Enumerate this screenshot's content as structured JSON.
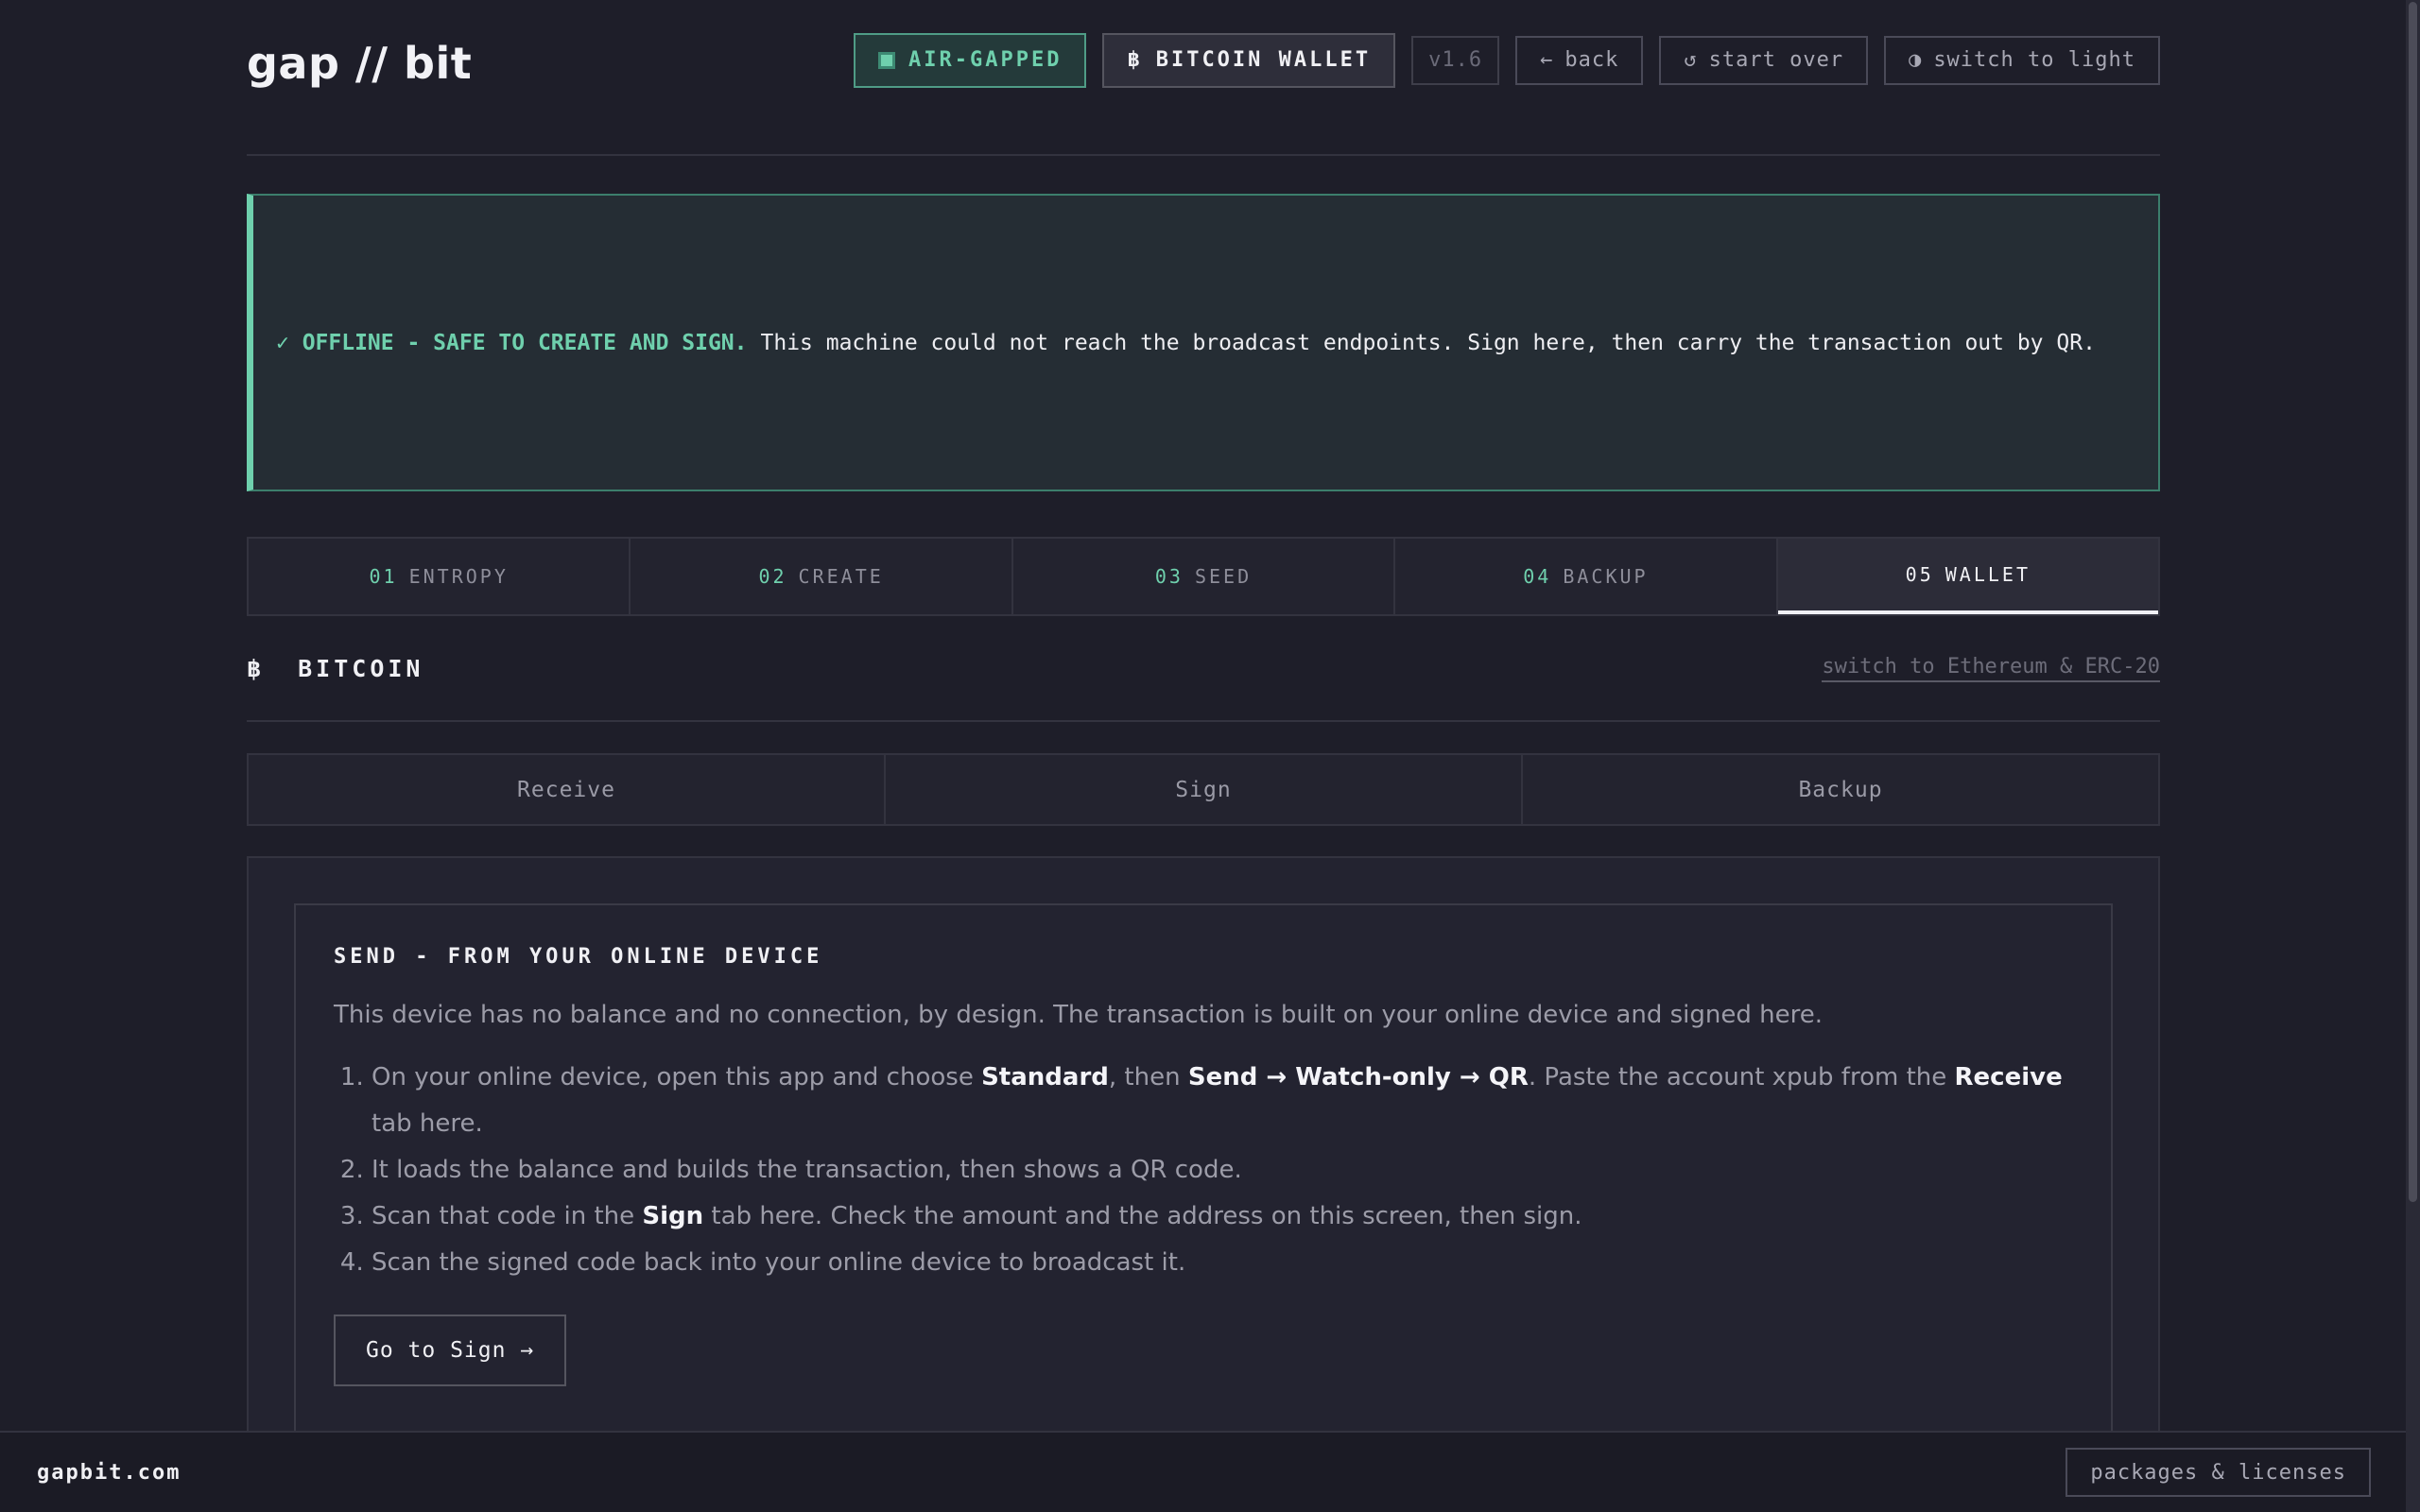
{
  "header": {
    "logo": "gap // bit",
    "air_gapped": "AIR-GAPPED",
    "wallet_symbol": "฿",
    "wallet_label": "BITCOIN WALLET",
    "version": "v1.6",
    "back_glyph": "←",
    "back": "back",
    "start_over_glyph": "↺",
    "start_over": "start over",
    "theme_glyph": "◑",
    "theme": "switch to light"
  },
  "banner": {
    "status": "✓ OFFLINE - SAFE TO CREATE AND SIGN.",
    "message": "This machine could not reach the broadcast endpoints. Sign here, then carry the transaction out by QR."
  },
  "steps": [
    {
      "num": "01",
      "label": "ENTROPY"
    },
    {
      "num": "02",
      "label": "CREATE"
    },
    {
      "num": "03",
      "label": "SEED"
    },
    {
      "num": "04",
      "label": "BACKUP"
    },
    {
      "num": "05",
      "label": "WALLET"
    }
  ],
  "section": {
    "symbol": "฿",
    "title": "BITCOIN",
    "switch_link": "switch to Ethereum & ERC-20"
  },
  "subtabs": [
    "Receive",
    "Sign",
    "Backup"
  ],
  "card": {
    "title": "SEND - FROM YOUR ONLINE DEVICE",
    "description": "This device has no balance and no connection, by design. The transaction is built on your online device and signed here.",
    "step1": {
      "a": "On your online device, open this app and choose ",
      "b": "Standard",
      "c": ", then ",
      "d": "Send → Watch-only → QR",
      "e": ". Paste the account xpub from the ",
      "f": "Receive",
      "g": " tab here."
    },
    "step2": "It loads the balance and builds the transaction, then shows a QR code.",
    "step3": {
      "a": "Scan that code in the ",
      "b": "Sign",
      "c": " tab here. Check the amount and the address on this screen, then sign."
    },
    "step4": "Scan the signed code back into your online device to broadcast it.",
    "button": "Go to Sign →"
  },
  "footer": {
    "brand": "gapbit.com",
    "link": "packages & licenses"
  },
  "colors": {
    "background": "#1e1e29",
    "accent_green": "#6fd0ad",
    "text": "#f0f0f4",
    "muted": "#9c9ca8"
  }
}
